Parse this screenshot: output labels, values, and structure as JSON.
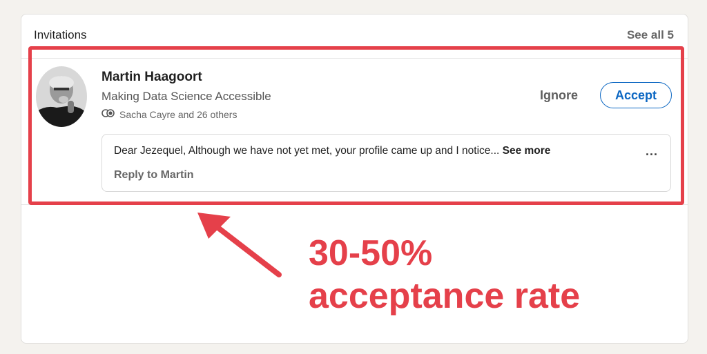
{
  "card": {
    "title": "Invitations",
    "see_all": "See all 5"
  },
  "invitation": {
    "name": "Martin Haagoort",
    "headline": "Making Data Science Accessible",
    "mutual": "Sacha Cayre and 26 others",
    "ignore_label": "Ignore",
    "accept_label": "Accept",
    "message": "Dear Jezequel, Although we have not yet met, your profile came up and I notice...",
    "see_more": "See more",
    "more_dots": "...",
    "reply_label": "Reply to Martin"
  },
  "annotation": {
    "line1": "30-50%",
    "line2": "acceptance rate"
  },
  "colors": {
    "annotation_red": "#e5404a",
    "accept_blue": "#0a66c2"
  },
  "icons": {
    "mutual": "mutual-connections-icon",
    "avatar": "profile-photo",
    "arrow": "pointer-arrow"
  }
}
